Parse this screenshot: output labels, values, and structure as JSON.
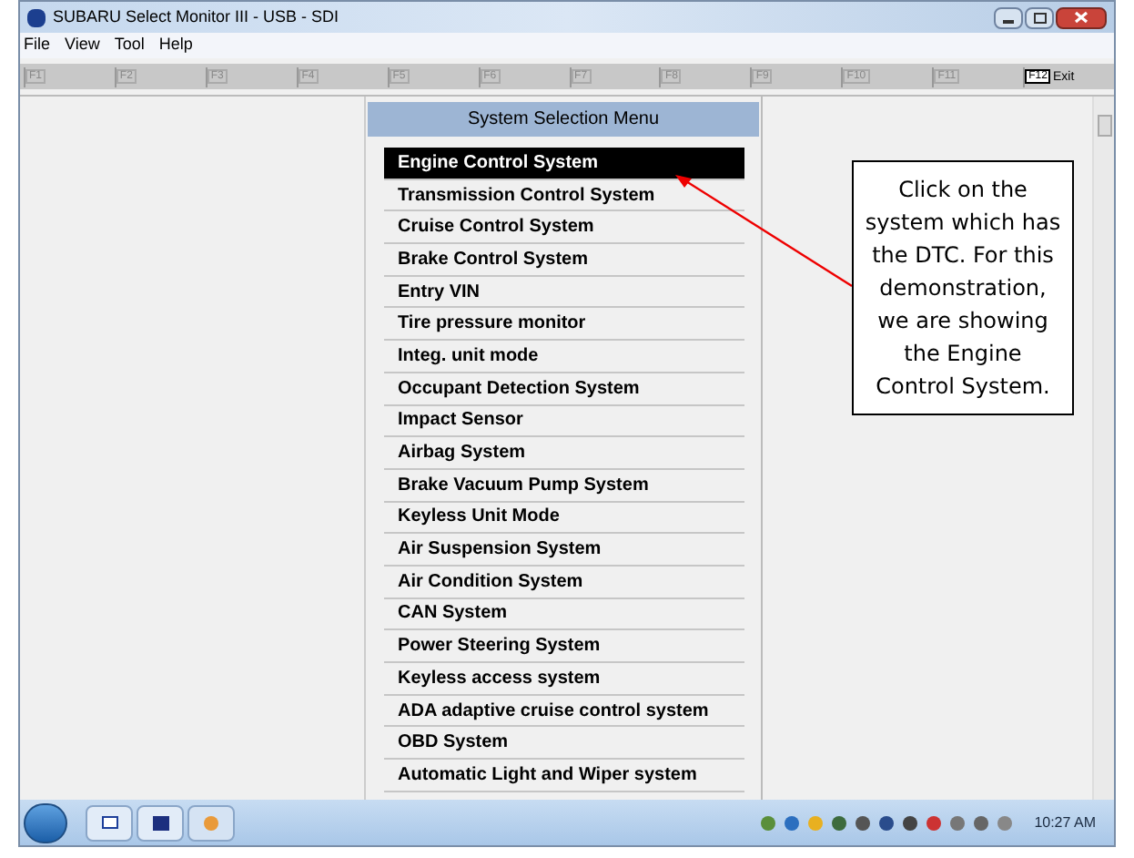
{
  "window": {
    "title": "SUBARU Select Monitor III - USB - SDI"
  },
  "menu": [
    "File",
    "View",
    "Tool",
    "Help"
  ],
  "function_keys": [
    {
      "key": "F1"
    },
    {
      "key": "F2"
    },
    {
      "key": "F3"
    },
    {
      "key": "F4"
    },
    {
      "key": "F5"
    },
    {
      "key": "F6"
    },
    {
      "key": "F7"
    },
    {
      "key": "F8"
    },
    {
      "key": "F9"
    },
    {
      "key": "F10"
    },
    {
      "key": "F11"
    },
    {
      "key": "F12",
      "label": "Exit"
    }
  ],
  "menu_panel": {
    "title": "System Selection Menu",
    "items": [
      {
        "label": "Engine Control System",
        "selected": true
      },
      {
        "label": "Transmission Control System",
        "selected": false
      },
      {
        "label": "Cruise Control System",
        "selected": false
      },
      {
        "label": "Brake Control System",
        "selected": false
      },
      {
        "label": "Entry VIN",
        "selected": false
      },
      {
        "label": "Tire pressure monitor",
        "selected": false
      },
      {
        "label": "Integ. unit mode",
        "selected": false
      },
      {
        "label": "Occupant Detection System",
        "selected": false
      },
      {
        "label": "Impact Sensor",
        "selected": false
      },
      {
        "label": "Airbag System",
        "selected": false
      },
      {
        "label": "Brake Vacuum Pump System",
        "selected": false
      },
      {
        "label": "Keyless Unit Mode",
        "selected": false
      },
      {
        "label": "Air Suspension System",
        "selected": false
      },
      {
        "label": "Air Condition System",
        "selected": false
      },
      {
        "label": "CAN System",
        "selected": false
      },
      {
        "label": "Power Steering System",
        "selected": false
      },
      {
        "label": "Keyless access system",
        "selected": false
      },
      {
        "label": "ADA adaptive cruise control system",
        "selected": false
      },
      {
        "label": "OBD System",
        "selected": false
      },
      {
        "label": "Automatic Light and Wiper system",
        "selected": false
      }
    ]
  },
  "callout": {
    "text": "Click on the system which has the DTC. For this demonstration, we are showing the Engine Control System."
  },
  "taskbar": {
    "clock": "10:27 AM"
  }
}
